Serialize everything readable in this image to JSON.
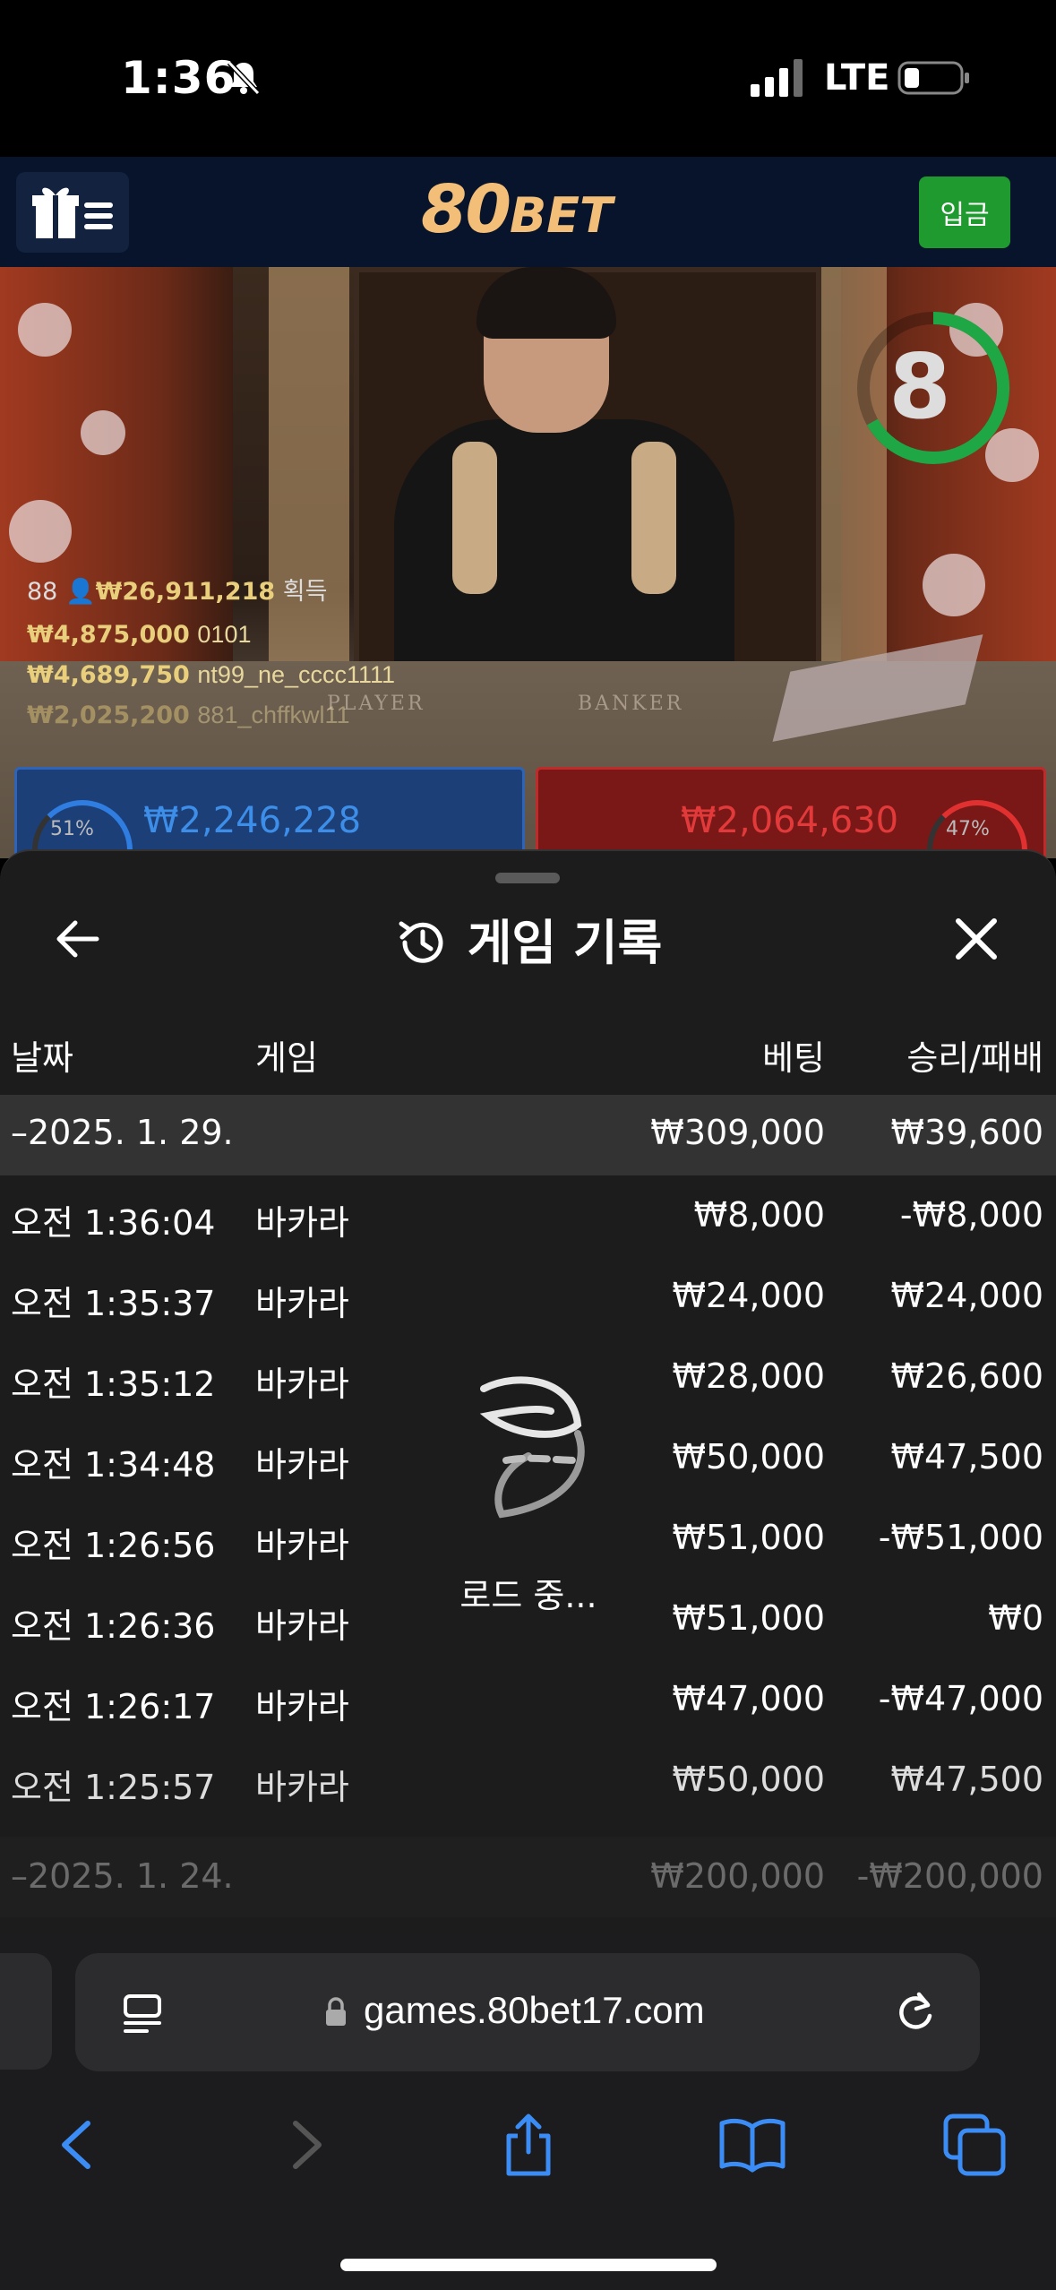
{
  "status_bar": {
    "time": "1:36",
    "network": "LTE"
  },
  "site_header": {
    "logo_number": "80",
    "logo_text": "BET",
    "deposit_label": "입금"
  },
  "live_video": {
    "countdown": "8",
    "table_labels": {
      "player": "PLAYER",
      "banker": "BANKER"
    },
    "winners": {
      "round_count": "88",
      "total_amount": "₩26,911,218",
      "total_suffix": "획득",
      "lines": [
        {
          "amount": "₩4,875,000",
          "user": "0101"
        },
        {
          "amount": "₩4,689,750",
          "user": "nt99_ne_cccc1111"
        },
        {
          "amount": "₩2,025,200",
          "user": "881_chffkwl11"
        }
      ]
    },
    "player_bet": {
      "total": "₩2,246,228",
      "percent": "51%"
    },
    "banker_bet": {
      "total": "₩2,064,630",
      "percent": "47%"
    }
  },
  "history": {
    "title": "게임 기록",
    "columns": {
      "date": "날짜",
      "game": "게임",
      "bet": "베팅",
      "winloss": "승리/패배"
    },
    "date_group": {
      "label": "–2025. 1. 29.",
      "bet_total": "₩309,000",
      "win_total": "₩39,600"
    },
    "rows": [
      {
        "time": "오전 1:36:04",
        "game": "바카라",
        "bet": "₩8,000",
        "result": "-₩8,000"
      },
      {
        "time": "오전 1:35:37",
        "game": "바카라",
        "bet": "₩24,000",
        "result": "₩24,000"
      },
      {
        "time": "오전 1:35:12",
        "game": "바카라",
        "bet": "₩28,000",
        "result": "₩26,600"
      },
      {
        "time": "오전 1:34:48",
        "game": "바카라",
        "bet": "₩50,000",
        "result": "₩47,500"
      },
      {
        "time": "오전 1:26:56",
        "game": "바카라",
        "bet": "₩51,000",
        "result": "-₩51,000"
      },
      {
        "time": "오전 1:26:36",
        "game": "바카라",
        "bet": "₩51,000",
        "result": "₩0"
      },
      {
        "time": "오전 1:26:17",
        "game": "바카라",
        "bet": "₩47,000",
        "result": "-₩47,000"
      },
      {
        "time": "오전 1:25:57",
        "game": "바카라",
        "bet": "₩50,000",
        "result": "₩47,500"
      }
    ],
    "next_group": {
      "label": "–2025. 1. 24.",
      "bet_total": "₩200,000",
      "win_total": "-₩200,000"
    },
    "loading_text": "로드 중..."
  },
  "safari": {
    "url": "games.80bet17.com"
  },
  "colors": {
    "accent_green": "#1e9a2e",
    "logo_gold": "#f2be78",
    "player_blue": "#3d8ee8",
    "banker_red": "#e23a3a",
    "ios_blue": "#3b8cf5"
  },
  "icons": [
    "bell-slash-icon",
    "signal-icon",
    "battery-icon",
    "gift-menu-icon",
    "history-icon",
    "back-arrow-icon",
    "close-icon",
    "loading-spinner-icon",
    "reader-icon",
    "lock-icon",
    "reload-icon",
    "back-icon",
    "forward-icon",
    "share-icon",
    "bookmarks-icon",
    "tabs-icon"
  ]
}
